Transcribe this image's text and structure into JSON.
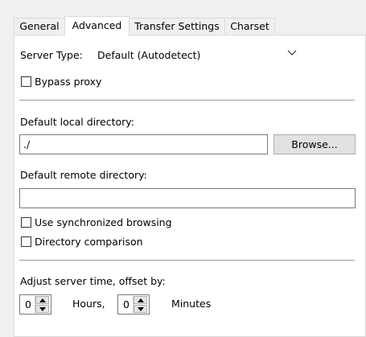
{
  "tabs": [
    "General",
    "Advanced",
    "Transfer Settings",
    "Charset"
  ],
  "server_type": {
    "label": "Server Type:",
    "value": "Default (Autodetect)"
  },
  "bypass_proxy": {
    "label": "Bypass proxy",
    "checked": false
  },
  "local_dir": {
    "label": "Default local directory:",
    "value": "./",
    "browse_label": "Browse..."
  },
  "remote_dir": {
    "label": "Default remote directory:",
    "value": ""
  },
  "sync_browsing": {
    "label": "Use synchronized browsing",
    "checked": false
  },
  "dir_comparison": {
    "label": "Directory comparison",
    "checked": false
  },
  "time_offset": {
    "label": "Adjust server time, offset by:",
    "hours_value": "0",
    "hours_label": "Hours,",
    "minutes_value": "0",
    "minutes_label": "Minutes"
  }
}
